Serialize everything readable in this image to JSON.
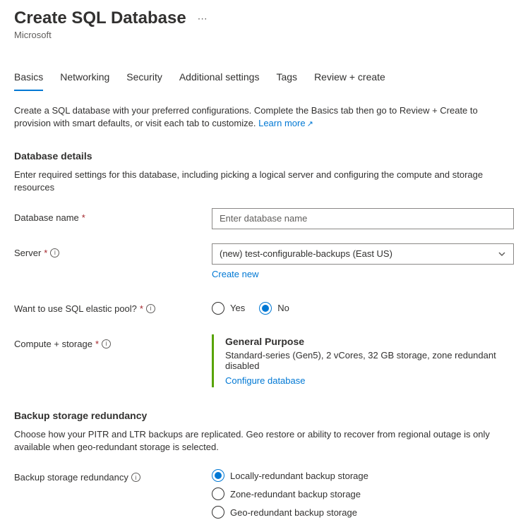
{
  "header": {
    "title": "Create SQL Database",
    "subtitle": "Microsoft"
  },
  "tabs": [
    "Basics",
    "Networking",
    "Security",
    "Additional settings",
    "Tags",
    "Review + create"
  ],
  "intro": {
    "text": "Create a SQL database with your preferred configurations. Complete the Basics tab then go to Review + Create to provision with smart defaults, or visit each tab to customize. ",
    "learn_more": "Learn more"
  },
  "db_details": {
    "heading": "Database details",
    "desc": "Enter required settings for this database, including picking a logical server and configuring the compute and storage resources",
    "name_label": "Database name",
    "name_placeholder": "Enter database name",
    "server_label": "Server",
    "server_value": "(new) test-configurable-backups (East US)",
    "create_new": "Create new",
    "pool_label": "Want to use SQL elastic pool?",
    "yes": "Yes",
    "no": "No",
    "compute_label": "Compute + storage",
    "compute_title": "General Purpose",
    "compute_desc": "Standard-series (Gen5), 2 vCores, 32 GB storage, zone redundant disabled",
    "configure": "Configure database"
  },
  "backup": {
    "heading": "Backup storage redundancy",
    "desc": "Choose how your PITR and LTR backups are replicated. Geo restore or ability to recover from regional outage is only available when geo-redundant storage is selected.",
    "label": "Backup storage redundancy",
    "options": [
      "Locally-redundant backup storage",
      "Zone-redundant backup storage",
      "Geo-redundant backup storage"
    ]
  }
}
